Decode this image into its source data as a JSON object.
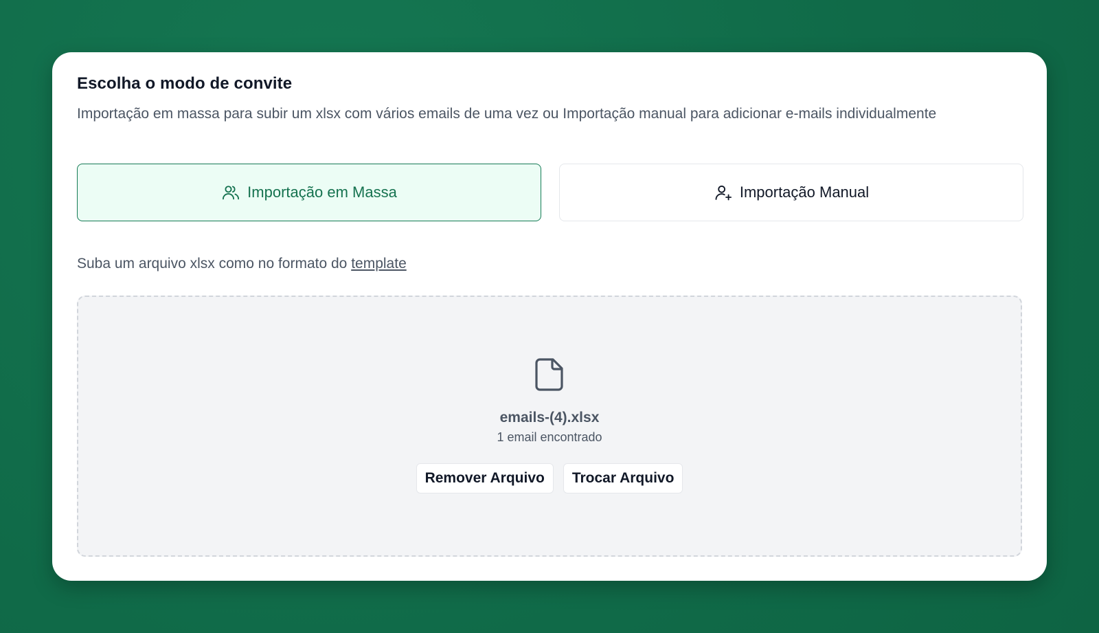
{
  "dialog": {
    "title": "Escolha o modo de convite",
    "subtitle": "Importação em massa para subir um xlsx com vários emails de uma vez ou Importação manual para adicionar e-mails individualmente"
  },
  "modes": {
    "mass": {
      "label": "Importação em Massa",
      "icon": "users-icon",
      "selected": true
    },
    "manual": {
      "label": "Importação Manual",
      "icon": "user-plus-icon",
      "selected": false
    }
  },
  "upload": {
    "hint": "Suba um arquivo xlsx como no formato do ",
    "template_link": "template",
    "file_icon": "file-icon",
    "file_name": "emails-(4).xlsx",
    "file_summary": "1 email encontrado",
    "remove_label": "Remover Arquivo",
    "replace_label": "Trocar Arquivo"
  },
  "colors": {
    "background": "#12704e",
    "accent": "#15724f",
    "accent_bg": "#ecfdf5",
    "text_primary": "#111827",
    "text_secondary": "#4b5563"
  }
}
